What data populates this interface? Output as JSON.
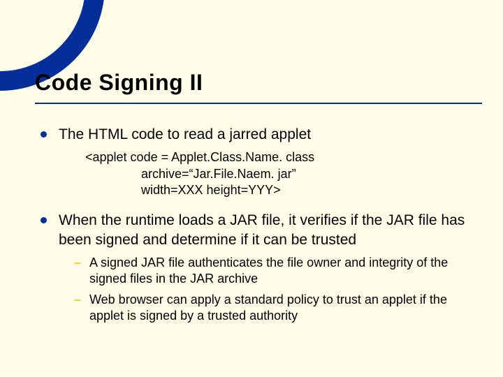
{
  "title": "Code Signing II",
  "bullets": {
    "b1": "The HTML code to read a jarred applet",
    "b2": "When the runtime loads a JAR file, it verifies if the JAR file has been signed and determine if it can be trusted"
  },
  "code": {
    "line1": "<applet code = Applet.Class.Name. class",
    "line2": "archive=“Jar.File.Naem. jar”",
    "line3": "width=XXX height=YYY>"
  },
  "subs": {
    "s1": "A signed JAR file authenticates the file owner and integrity of the signed files in the JAR archive",
    "s2": "Web browser can apply a standard policy to trust an applet if the applet is signed by a trusted authority"
  }
}
